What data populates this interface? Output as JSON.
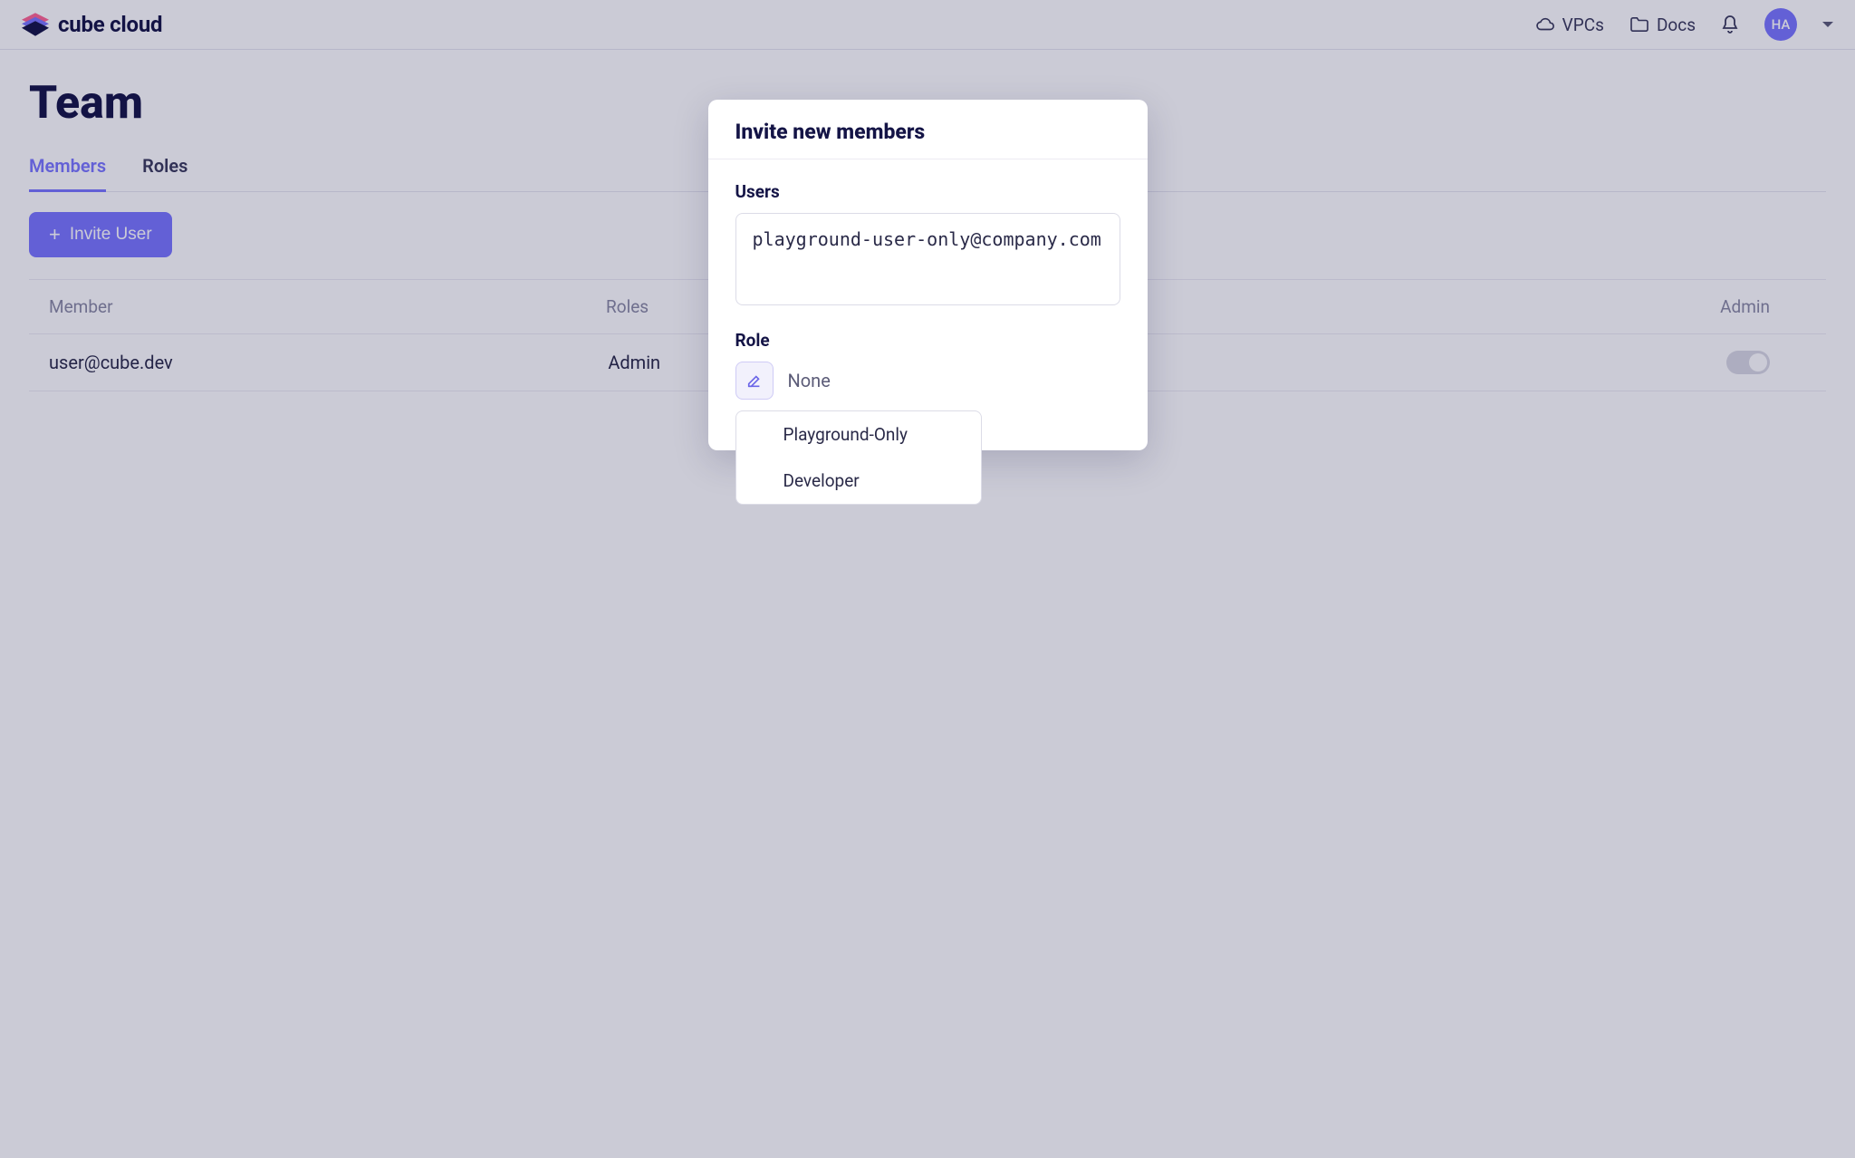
{
  "brand": {
    "name": "cube cloud"
  },
  "topnav": {
    "vpcs": "VPCs",
    "docs": "Docs",
    "avatar_initials": "HA"
  },
  "page": {
    "title": "Team",
    "tabs": {
      "members": "Members",
      "roles": "Roles"
    },
    "invite_button": "Invite User",
    "table": {
      "columns": {
        "member": "Member",
        "roles": "Roles",
        "admin": "Admin"
      },
      "rows": [
        {
          "member": "user@cube.dev",
          "roles": "Admin",
          "admin": false
        }
      ]
    }
  },
  "modal": {
    "title": "Invite new members",
    "users_label": "Users",
    "users_value": "playground-user-only@company.com",
    "role_label": "Role",
    "role_value": "None",
    "role_options": [
      "Playground-Only",
      "Developer"
    ]
  }
}
